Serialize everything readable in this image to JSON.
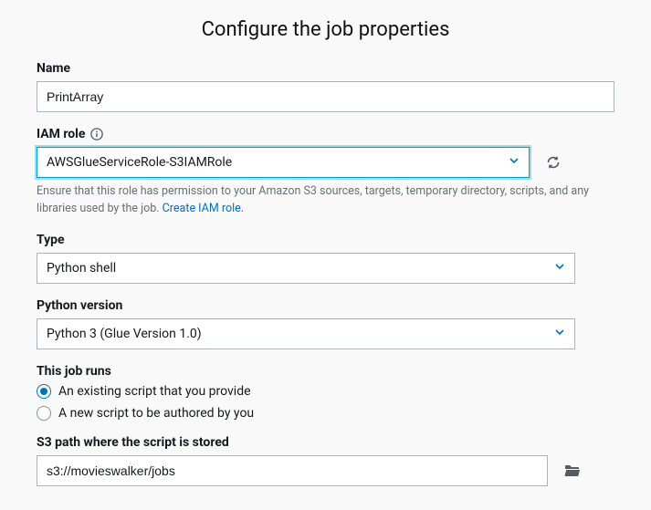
{
  "title": "Configure the job properties",
  "fields": {
    "name": {
      "label": "Name",
      "value": "PrintArray"
    },
    "iam_role": {
      "label": "IAM role",
      "value": "AWSGlueServiceRole-S3IAMRole",
      "helper_prefix": "Ensure that this role has permission to your Amazon S3 sources, targets, temporary directory, scripts, and any libraries used by the job. ",
      "helper_link": "Create IAM role."
    },
    "type": {
      "label": "Type",
      "value": "Python shell"
    },
    "python_version": {
      "label": "Python version",
      "value": "Python 3 (Glue Version 1.0)"
    },
    "job_runs": {
      "label": "This job runs",
      "options": {
        "existing": "An existing script that you provide",
        "new": "A new script to be authored by you"
      },
      "selected": "existing"
    },
    "s3_path": {
      "label": "S3 path where the script is stored",
      "value": "s3://movieswalker/jobs"
    }
  }
}
